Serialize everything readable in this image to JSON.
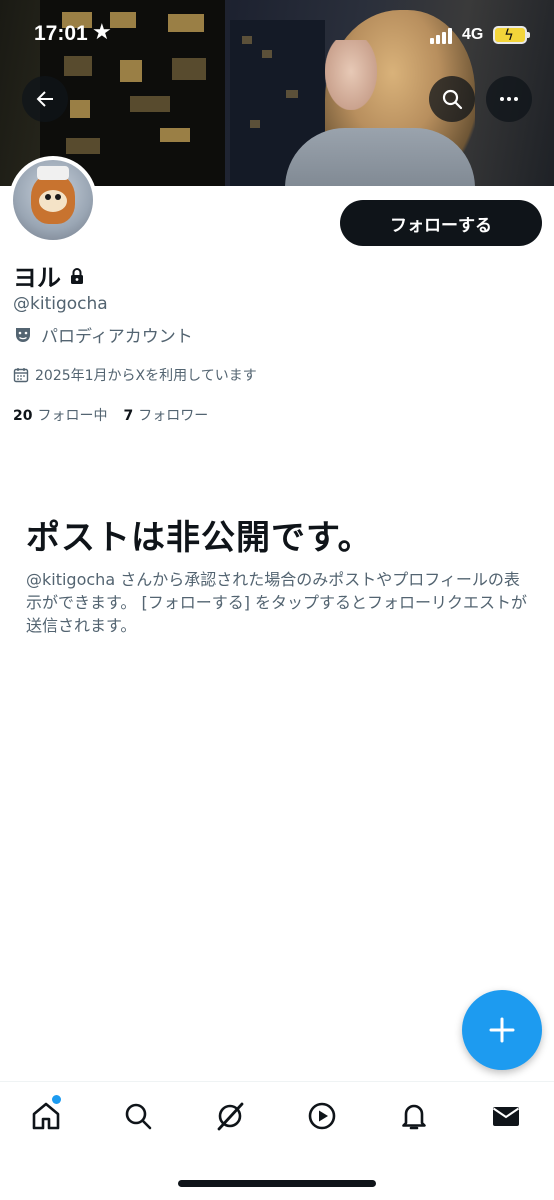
{
  "status_bar": {
    "time": "17:01",
    "network": "4G"
  },
  "profile": {
    "display_name": "ヨル",
    "handle": "@kitigocha",
    "parody_label": "パロディアカウント",
    "joined": "2025年1月からXを利用しています",
    "following_count": "20",
    "following_label": "フォロー中",
    "followers_count": "7",
    "followers_label": "フォロワー"
  },
  "actions": {
    "follow_label": "フォローする"
  },
  "private_notice": {
    "title": "ポストは非公開です。",
    "description": "@kitigocha さんから承認された場合のみポストやプロフィールの表示ができます。 [フォローする] をタップするとフォローリクエストが送信されます。"
  },
  "bottom_nav": {
    "items": [
      "home-icon",
      "search-icon",
      "grok-icon",
      "video-icon",
      "notifications-icon",
      "messages-icon"
    ]
  },
  "colors": {
    "accent": "#1d9bf0",
    "text_primary": "#0f1419",
    "text_secondary": "#536471",
    "follow_button_bg": "#0f1419"
  }
}
